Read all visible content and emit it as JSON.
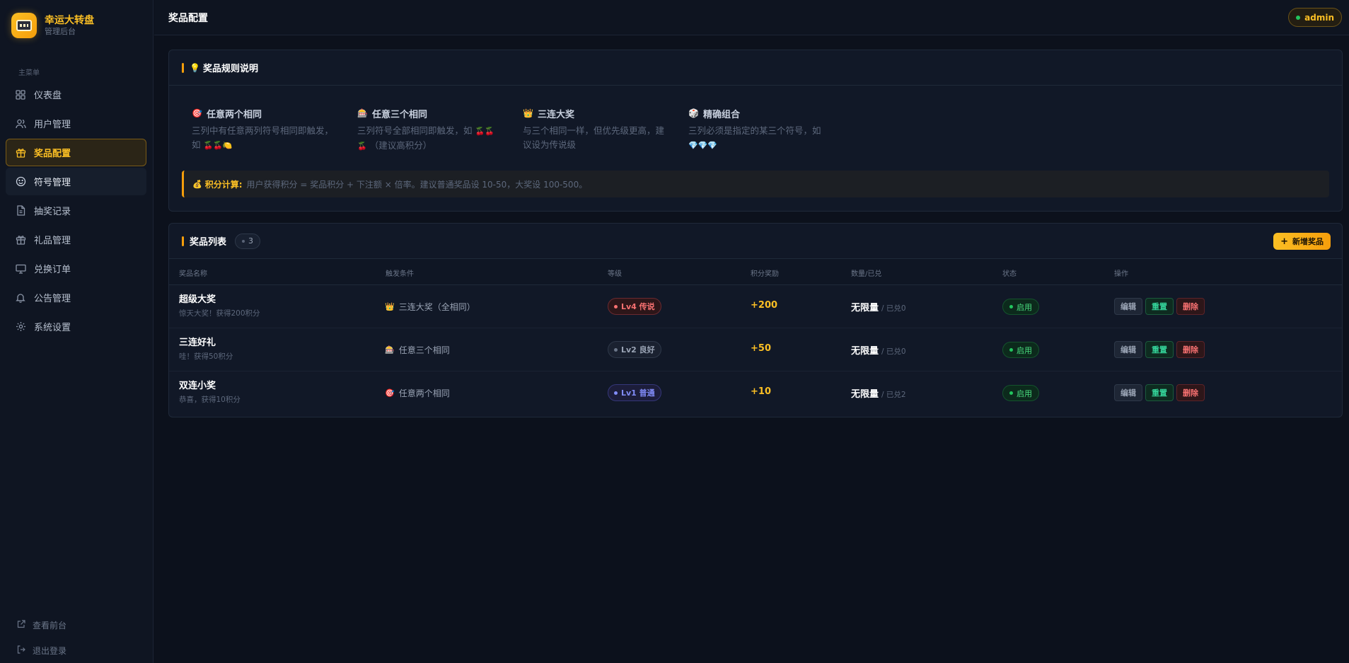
{
  "brand": {
    "title": "幸运大转盘",
    "subtitle": "管理后台"
  },
  "sidebar": {
    "section_label": "主菜单",
    "items": [
      {
        "label": "仪表盘",
        "icon": "grid-icon"
      },
      {
        "label": "用户管理",
        "icon": "users-icon"
      },
      {
        "label": "奖品配置",
        "icon": "gift-icon",
        "active": true
      },
      {
        "label": "符号管理",
        "icon": "smile-icon",
        "hover": true
      },
      {
        "label": "抽奖记录",
        "icon": "file-icon"
      },
      {
        "label": "礼品管理",
        "icon": "gift-icon"
      },
      {
        "label": "兑换订单",
        "icon": "monitor-icon"
      },
      {
        "label": "公告管理",
        "icon": "bell-icon"
      },
      {
        "label": "系统设置",
        "icon": "gear-icon"
      }
    ],
    "bottom": [
      {
        "label": "查看前台",
        "icon": "external-link-icon"
      },
      {
        "label": "退出登录",
        "icon": "logout-icon"
      }
    ]
  },
  "header": {
    "title": "奖品配置",
    "user": "admin"
  },
  "rules": {
    "title": "奖品规则说明",
    "items": [
      {
        "icon": "🎯",
        "title": "任意两个相同",
        "desc": "三列中有任意两列符号相同即触发，如",
        "emoji": "🍒🍒🍋"
      },
      {
        "icon": "🎰",
        "title": "任意三个相同",
        "desc": "三列符号全部相同即触发，如",
        "emoji": "🍒🍒🍒",
        "suffix": "（建议高积分）"
      },
      {
        "icon": "👑",
        "title": "三连大奖",
        "desc": "与三个相同一样，但优先级更高，建议设为传说级",
        "emoji": "",
        "suffix": ""
      },
      {
        "icon": "🎲",
        "title": "精确组合",
        "desc": "三列必须是指定的某三个符号，如",
        "emoji": "💎💎💎",
        "suffix": ""
      }
    ],
    "score_note": {
      "label": "积分计算:",
      "text": "用户获得积分 = 奖品积分 + 下注额 × 倍率。建议普通奖品设 10-50，大奖设 100-500。"
    }
  },
  "prize_list": {
    "title": "奖品列表",
    "count": "3",
    "add_label": "新增奖品",
    "columns": [
      "奖品名称",
      "触发条件",
      "等级",
      "积分奖励",
      "数量/已兑",
      "状态",
      "操作"
    ],
    "rows": [
      {
        "name": "超级大奖",
        "desc": "惊天大奖！获得200积分",
        "cond_icon": "👑",
        "condition": "三连大奖（全相同）",
        "level": "Lv4 传说",
        "level_color": "#f87171",
        "points": "+200",
        "qty": "无限量",
        "redeemed": "/ 已兑0",
        "status": "启用"
      },
      {
        "name": "三连好礼",
        "desc": "哇！获得50积分",
        "cond_icon": "🎰",
        "condition": "任意三个相同",
        "level": "Lv2 良好",
        "level_color": "#9aa4b5",
        "points": "+50",
        "qty": "无限量",
        "redeemed": "/ 已兑0",
        "status": "启用"
      },
      {
        "name": "双连小奖",
        "desc": "恭喜，获得10积分",
        "cond_icon": "🎯",
        "condition": "任意两个相同",
        "level": "Lv1 普通",
        "level_color": "#818cf8",
        "points": "+10",
        "qty": "无限量",
        "redeemed": "/ 已兑2",
        "status": "启用"
      }
    ],
    "ops": {
      "edit": "编辑",
      "reset": "重置",
      "delete": "删除"
    }
  }
}
